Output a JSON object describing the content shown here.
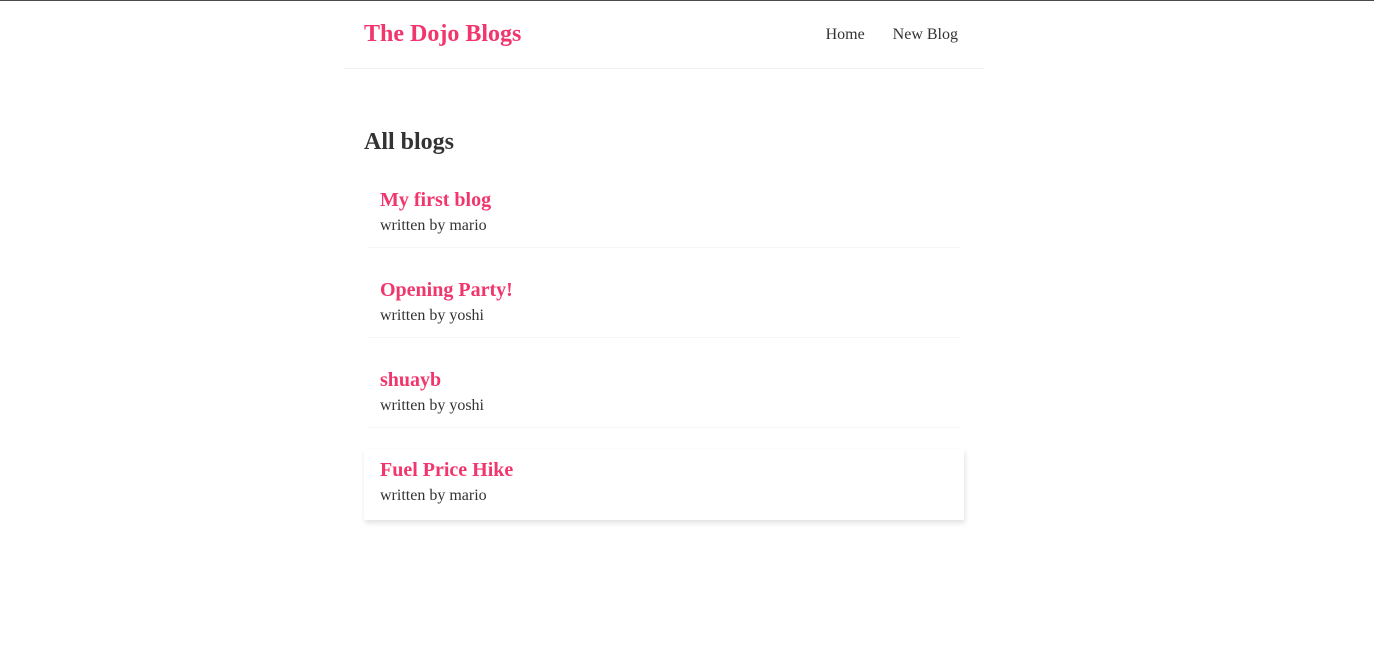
{
  "navbar": {
    "brand": "The Dojo Blogs",
    "links": [
      {
        "label": "Home"
      },
      {
        "label": "New Blog"
      }
    ]
  },
  "main": {
    "title": "All blogs",
    "blogs": [
      {
        "title": "My first blog",
        "author_line": "written by mario"
      },
      {
        "title": "Opening Party!",
        "author_line": "written by yoshi"
      },
      {
        "title": "shuayb",
        "author_line": "written by yoshi"
      },
      {
        "title": "Fuel Price Hike",
        "author_line": "written by mario"
      }
    ]
  },
  "colors": {
    "brand": "#f1356d",
    "text": "#333333",
    "background": "#ffffff"
  }
}
